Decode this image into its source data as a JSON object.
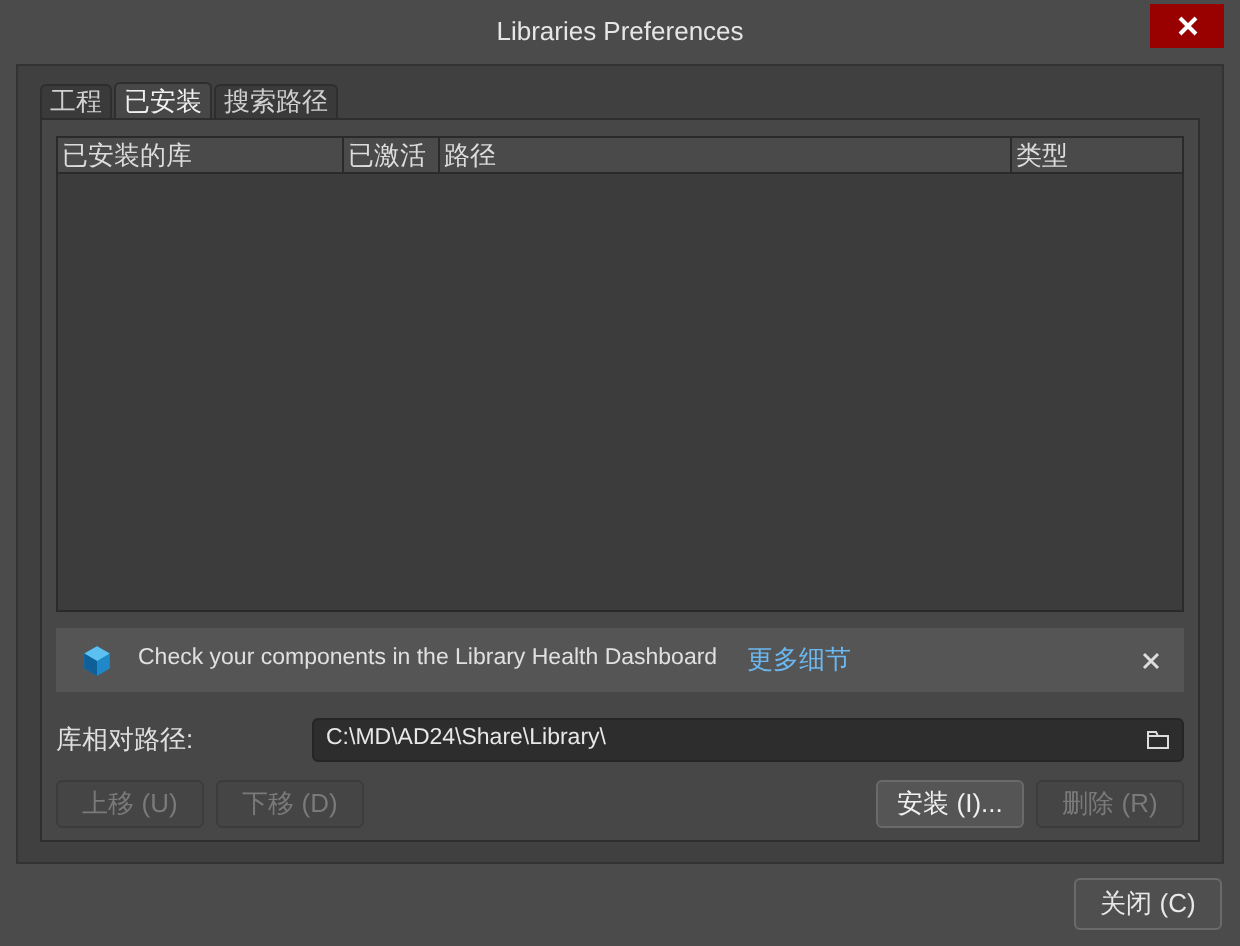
{
  "window": {
    "title": "Libraries Preferences"
  },
  "tabs": [
    {
      "label": "工程",
      "selected": false
    },
    {
      "label": "已安装",
      "selected": true
    },
    {
      "label": "搜索路径",
      "selected": false
    }
  ],
  "table": {
    "columns": [
      "已安装的库",
      "已激活",
      "路径",
      "类型"
    ]
  },
  "banner": {
    "message": "Check your components in the Library Health Dashboard",
    "link": "更多细节"
  },
  "relative_path": {
    "label": "库相对路径:",
    "value": "C:\\MD\\AD24\\Share\\Library\\"
  },
  "buttons": [
    {
      "label": "上移",
      "shortcut": "(U)",
      "disabled": true
    },
    {
      "label": "下移",
      "shortcut": "(D)",
      "disabled": true
    },
    {
      "label": "安装",
      "shortcut": "(I)...",
      "disabled": false
    },
    {
      "label": "删除",
      "shortcut": "(R)",
      "disabled": true
    }
  ],
  "close_button": {
    "label": "关闭",
    "shortcut": "(C)"
  }
}
